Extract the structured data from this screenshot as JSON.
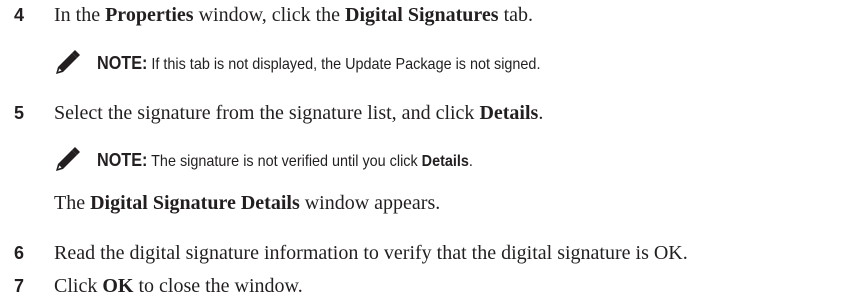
{
  "steps": [
    {
      "number": "4",
      "text": {
        "pre": "In the ",
        "b1": "Properties",
        "mid": " window, click the ",
        "b2": "Digital Signatures",
        "post": " tab."
      }
    },
    {
      "number": "5",
      "text": {
        "pre": "Select the signature from the signature list, and click ",
        "b1": "Details",
        "post": "."
      }
    },
    {
      "number": "6",
      "text": "Read the digital signature information to verify that the digital signature is OK."
    },
    {
      "number": "7",
      "text": {
        "pre": "Click ",
        "b1": "OK",
        "post": " to close the window."
      }
    }
  ],
  "notes": [
    {
      "label": "NOTE:",
      "text": " If this tab is not displayed, the Update Package is not signed."
    },
    {
      "label": "NOTE:",
      "pre": " The signature is not verified until you click ",
      "bold": "Details",
      "post": "."
    }
  ],
  "result": {
    "pre": "The ",
    "bold": "Digital Signature Details",
    "post": " window appears."
  },
  "icons": {
    "note": "pencil-note-icon"
  }
}
